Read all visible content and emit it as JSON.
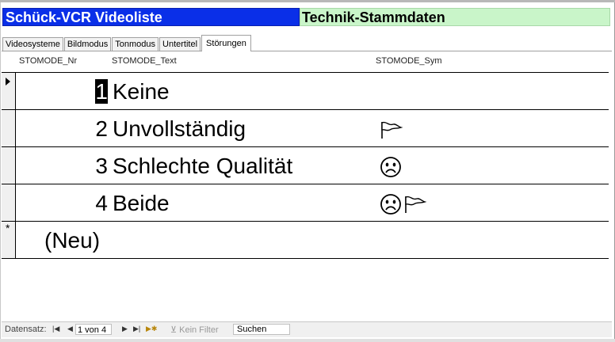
{
  "header": {
    "title": "Schück-VCR Videoliste",
    "subtitle": "Technik-Stammdaten"
  },
  "tabs": [
    {
      "label": "Videosysteme",
      "active": false
    },
    {
      "label": "Bildmodus",
      "active": false
    },
    {
      "label": "Tonmodus",
      "active": false
    },
    {
      "label": "Untertitel",
      "active": false
    },
    {
      "label": "Störungen",
      "active": true
    }
  ],
  "columns": {
    "nr": "STOMODE_Nr",
    "text": "STOMODE_Text",
    "sym": "STOMODE_Sym"
  },
  "rows": [
    {
      "nr": "1",
      "text": "Keine",
      "sym": []
    },
    {
      "nr": "2",
      "text": "Unvollständig",
      "sym": [
        "flag-icon"
      ]
    },
    {
      "nr": "3",
      "text": "Schlechte Qualität",
      "sym": [
        "sad-face-icon"
      ]
    },
    {
      "nr": "4",
      "text": "Beide",
      "sym": [
        "sad-face-icon",
        "flag-icon"
      ]
    }
  ],
  "new_row": {
    "label": "(Neu)"
  },
  "statusbar": {
    "record_label": "Datensatz:",
    "record_value": "1 von 4",
    "filter_label": "Kein Filter",
    "search_value": "Suchen"
  }
}
